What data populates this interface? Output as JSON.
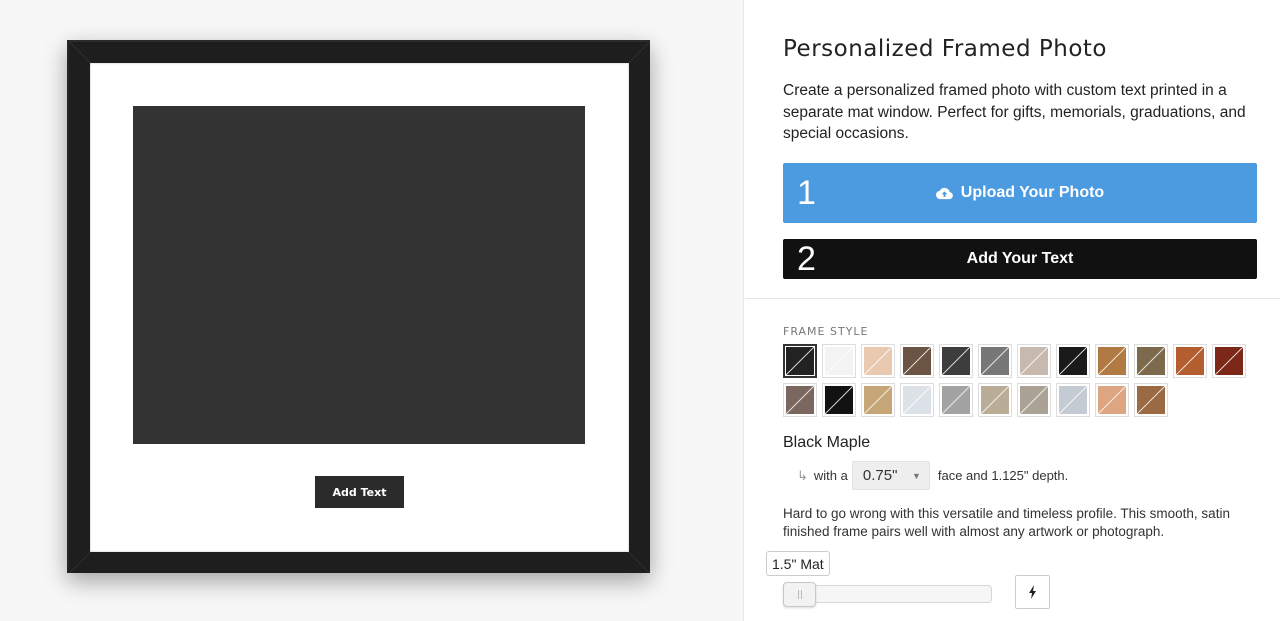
{
  "preview": {
    "add_text_label": "Add Text"
  },
  "product": {
    "title": "Personalized Framed Photo",
    "description": "Create a personalized framed photo with custom text printed in a separate mat window. Perfect for gifts, memorials, graduations, and special occasions."
  },
  "steps": {
    "upload": {
      "number": "1",
      "label": "Upload Your Photo",
      "icon": "cloud-upload-icon",
      "color": "#4c9ae0"
    },
    "text": {
      "number": "2",
      "label": "Add Your Text",
      "color": "#111111"
    }
  },
  "frame_style": {
    "label": "FRAME STYLE",
    "selected_name": "Black Maple",
    "swatches": [
      {
        "id": "black-maple",
        "fill": "#222222",
        "selected": true
      },
      {
        "id": "white",
        "fill": "#f3f3f3"
      },
      {
        "id": "natural-maple",
        "fill": "#e9c9b0"
      },
      {
        "id": "walnut",
        "fill": "#6b5444"
      },
      {
        "id": "charcoal-wood",
        "fill": "#3d3d3d"
      },
      {
        "id": "gray-wood",
        "fill": "#777777"
      },
      {
        "id": "whitewash",
        "fill": "#c7b9ad"
      },
      {
        "id": "black-gold",
        "fill": "#1a1a1a"
      },
      {
        "id": "honey-oak",
        "fill": "#b07a42"
      },
      {
        "id": "ornate-gold",
        "fill": "#7d6a4c"
      },
      {
        "id": "cherry",
        "fill": "#b45d2f"
      },
      {
        "id": "mahogany",
        "fill": "#7c2718"
      },
      {
        "id": "driftwood",
        "fill": "#7b6660"
      },
      {
        "id": "black-gloss",
        "fill": "#121212"
      },
      {
        "id": "light-oak",
        "fill": "#c6a577"
      },
      {
        "id": "white-silver",
        "fill": "#dde2e8"
      },
      {
        "id": "silver",
        "fill": "#a2a2a2"
      },
      {
        "id": "barnwood",
        "fill": "#b9ad98"
      },
      {
        "id": "stone-gray",
        "fill": "#aaa295"
      },
      {
        "id": "silver-blue",
        "fill": "#c5cbd2"
      },
      {
        "id": "antique-gold",
        "fill": "#dda582"
      },
      {
        "id": "baroque",
        "fill": "#9b6a43"
      }
    ],
    "face_prefix": "with a",
    "face_value": "0.75\"",
    "face_suffix": "face and 1.125\" depth.",
    "description": "Hard to go wrong with this versatile and timeless profile. This smooth, satin finished frame pairs well with almost any artwork or photograph."
  },
  "mat": {
    "label": "1.5\" Mat",
    "slider_fraction": 0.0
  },
  "colors": {
    "frame": "#1e1e1e",
    "photo_window": "#333333",
    "panel_bg": "#ffffff",
    "preview_bg": "#f7f7f7"
  }
}
